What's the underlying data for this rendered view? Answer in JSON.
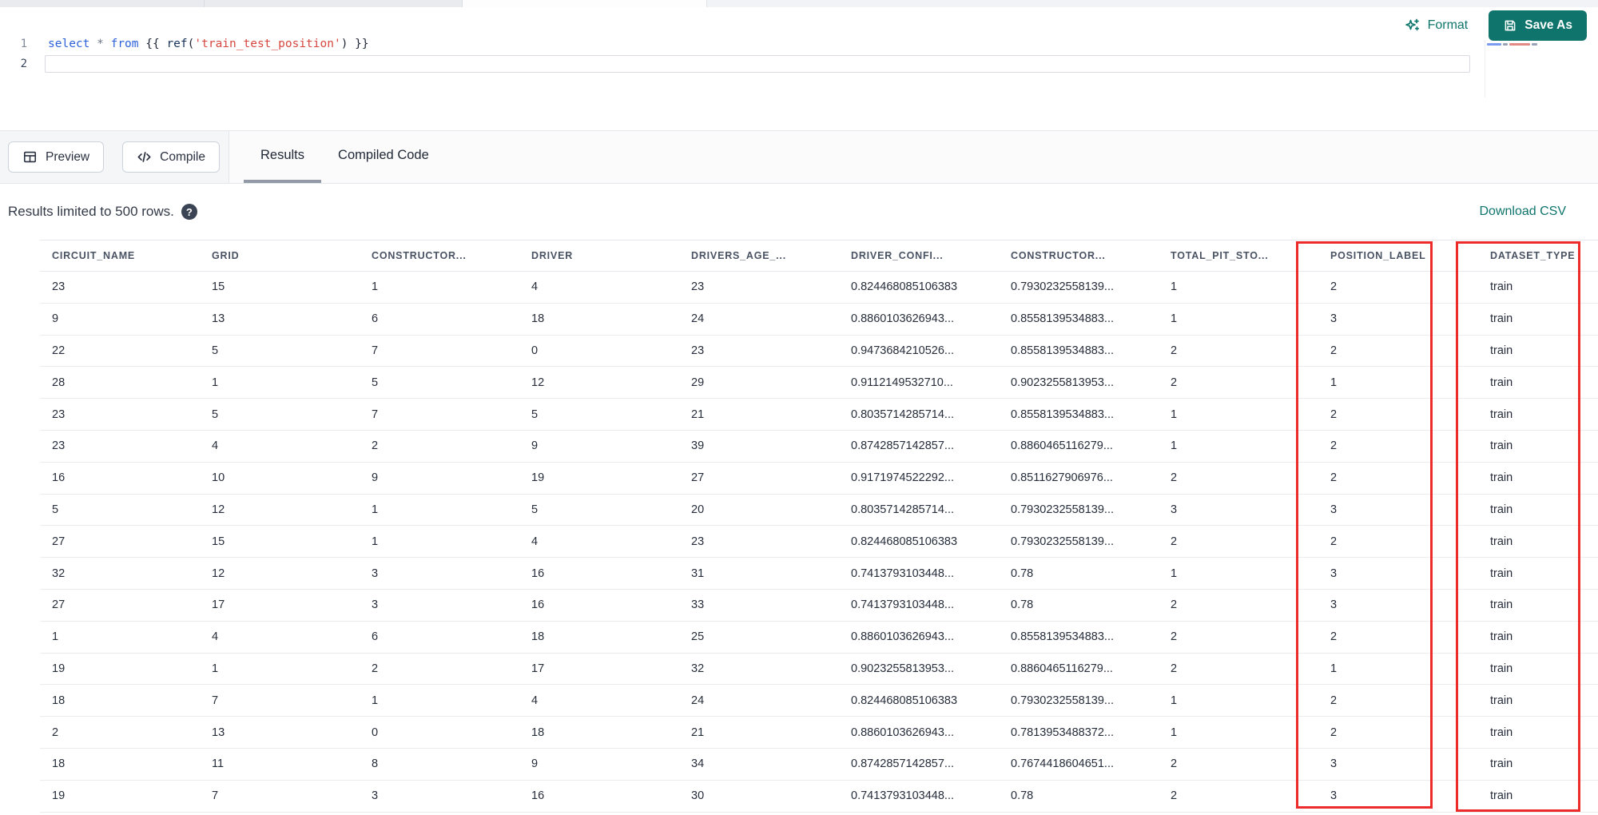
{
  "toolbar": {
    "format_label": "Format",
    "save_as_label": "Save As"
  },
  "editor": {
    "line1_number": "1",
    "line2_number": "2",
    "code_text": "select * from {{ ref('train_test_position') }}",
    "tokens": [
      {
        "text": "select",
        "type": "keyword"
      },
      {
        "text": " ",
        "type": "plain"
      },
      {
        "text": "*",
        "type": "operator"
      },
      {
        "text": " ",
        "type": "plain"
      },
      {
        "text": "from",
        "type": "keyword"
      },
      {
        "text": " {{ ",
        "type": "plain"
      },
      {
        "text": "ref",
        "type": "function"
      },
      {
        "text": "(",
        "type": "plain"
      },
      {
        "text": "'train_test_position'",
        "type": "string"
      },
      {
        "text": ") }}",
        "type": "plain"
      }
    ]
  },
  "panel": {
    "preview_label": "Preview",
    "compile_label": "Compile",
    "tabs": [
      {
        "label": "Results",
        "active": true
      },
      {
        "label": "Compiled Code",
        "active": false
      }
    ]
  },
  "results_bar": {
    "limit_notice": "Results limited to 500 rows.",
    "help_icon": "?",
    "download_csv_label": "Download CSV"
  },
  "table": {
    "columns": [
      "CIRCUIT_NAME",
      "GRID",
      "CONSTRUCTOR...",
      "DRIVER",
      "DRIVERS_AGE_...",
      "DRIVER_CONFI...",
      "CONSTRUCTOR...",
      "TOTAL_PIT_STO...",
      "POSITION_LABEL",
      "DATASET_TYPE"
    ],
    "highlighted_columns": [
      "POSITION_LABEL",
      "DATASET_TYPE"
    ],
    "rows": [
      [
        "23",
        "15",
        "1",
        "4",
        "23",
        "0.824468085106383",
        "0.7930232558139...",
        "1",
        "2",
        "train"
      ],
      [
        "9",
        "13",
        "6",
        "18",
        "24",
        "0.8860103626943...",
        "0.8558139534883...",
        "1",
        "3",
        "train"
      ],
      [
        "22",
        "5",
        "7",
        "0",
        "23",
        "0.9473684210526...",
        "0.8558139534883...",
        "2",
        "2",
        "train"
      ],
      [
        "28",
        "1",
        "5",
        "12",
        "29",
        "0.9112149532710...",
        "0.9023255813953...",
        "2",
        "1",
        "train"
      ],
      [
        "23",
        "5",
        "7",
        "5",
        "21",
        "0.8035714285714...",
        "0.8558139534883...",
        "1",
        "2",
        "train"
      ],
      [
        "23",
        "4",
        "2",
        "9",
        "39",
        "0.8742857142857...",
        "0.8860465116279...",
        "1",
        "2",
        "train"
      ],
      [
        "16",
        "10",
        "9",
        "19",
        "27",
        "0.9171974522292...",
        "0.8511627906976...",
        "2",
        "2",
        "train"
      ],
      [
        "5",
        "12",
        "1",
        "5",
        "20",
        "0.8035714285714...",
        "0.7930232558139...",
        "3",
        "3",
        "train"
      ],
      [
        "27",
        "15",
        "1",
        "4",
        "23",
        "0.824468085106383",
        "0.7930232558139...",
        "2",
        "2",
        "train"
      ],
      [
        "32",
        "12",
        "3",
        "16",
        "31",
        "0.7413793103448...",
        "0.78",
        "1",
        "3",
        "train"
      ],
      [
        "27",
        "17",
        "3",
        "16",
        "33",
        "0.7413793103448...",
        "0.78",
        "2",
        "3",
        "train"
      ],
      [
        "1",
        "4",
        "6",
        "18",
        "25",
        "0.8860103626943...",
        "0.8558139534883...",
        "2",
        "2",
        "train"
      ],
      [
        "19",
        "1",
        "2",
        "17",
        "32",
        "0.9023255813953...",
        "0.8860465116279...",
        "2",
        "1",
        "train"
      ],
      [
        "18",
        "7",
        "1",
        "4",
        "24",
        "0.824468085106383",
        "0.7930232558139...",
        "1",
        "2",
        "train"
      ],
      [
        "2",
        "13",
        "0",
        "18",
        "21",
        "0.8860103626943...",
        "0.7813953488372...",
        "1",
        "2",
        "train"
      ],
      [
        "18",
        "11",
        "8",
        "9",
        "34",
        "0.8742857142857...",
        "0.7674418604651...",
        "2",
        "3",
        "train"
      ],
      [
        "19",
        "7",
        "3",
        "16",
        "30",
        "0.7413793103448...",
        "0.78",
        "2",
        "3",
        "train"
      ]
    ]
  },
  "colors": {
    "accent_teal": "#0f756c",
    "highlight_red": "#ee2b2b",
    "keyword_blue": "#2d62d9",
    "string_red": "#d6473f"
  }
}
